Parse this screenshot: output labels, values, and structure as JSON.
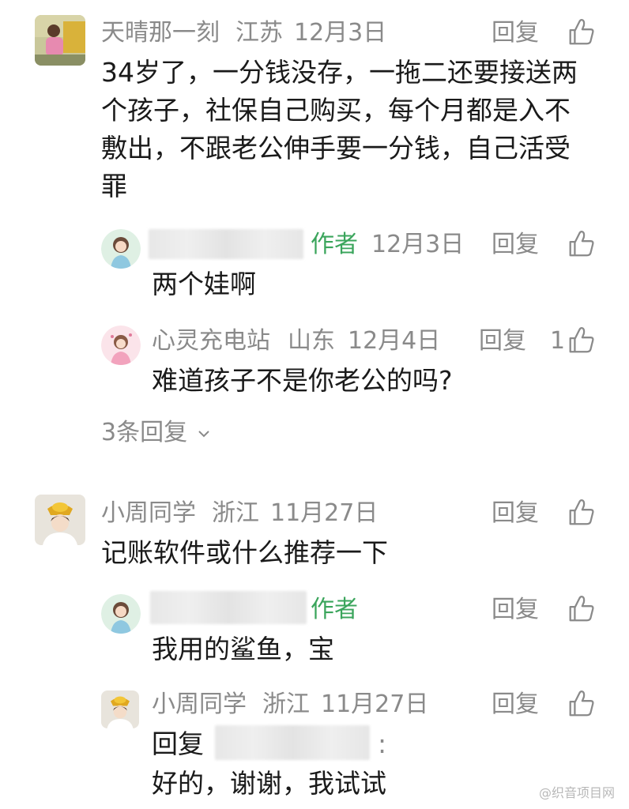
{
  "reply_label": "回复",
  "comments": [
    {
      "name": "天晴那一刻",
      "location": "江苏",
      "date": "12月3日",
      "lines": [
        "34岁了，一分钱没存，一拖二还要接送两",
        "个孩子，社保自己购买，每个月都是入不",
        "敷出，不跟老公伸手要一分钱，自己活受",
        "罪"
      ],
      "replies": [
        {
          "author_tag": "作者",
          "date": "12月3日",
          "text": "两个娃啊"
        },
        {
          "name": "心灵充电站",
          "location": "山东",
          "date": "12月4日",
          "likes": "1",
          "text": "难道孩子不是你老公的吗?"
        }
      ],
      "more_replies": "3条回复"
    },
    {
      "name": "小周同学",
      "location": "浙江",
      "date": "11月27日",
      "text": "记账软件或什么推荐一下",
      "replies": [
        {
          "author_tag": "作者",
          "text": "我用的鲨鱼，宝"
        },
        {
          "name": "小周同学",
          "location": "浙江",
          "date": "11月27日",
          "reply_prefix": "回复",
          "colon": ":",
          "text": "好的，谢谢，我试试"
        }
      ]
    }
  ],
  "watermark": "@织音项目网"
}
